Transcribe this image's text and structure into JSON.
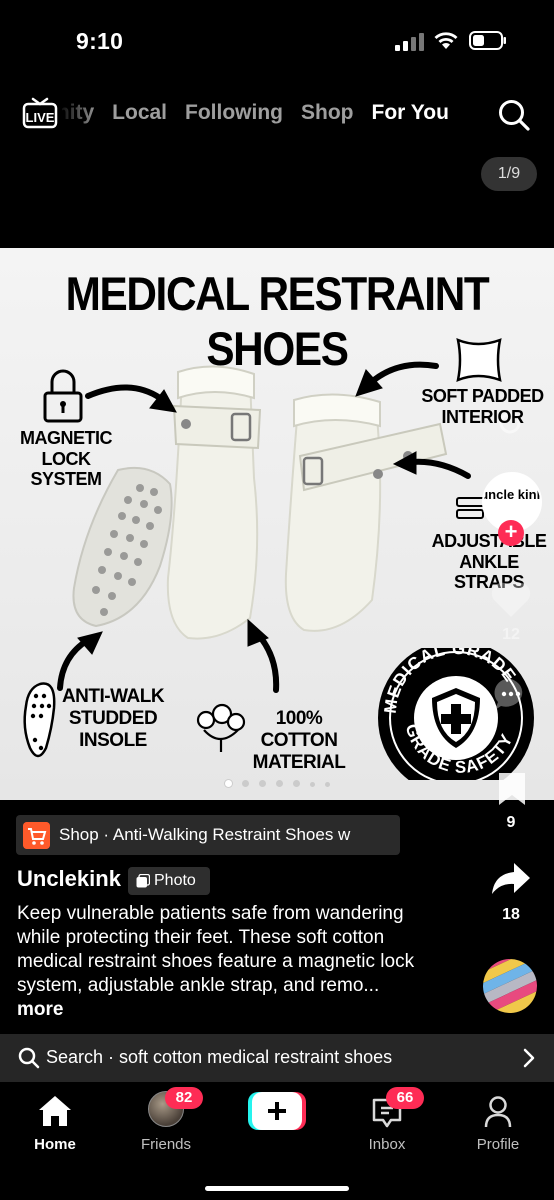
{
  "status_bar": {
    "time": "9:10"
  },
  "top_nav": {
    "live_label": "LIVE",
    "tabs": [
      "Community",
      "Local",
      "Following",
      "Shop",
      "For You"
    ],
    "visible_first_tab_fragment": "unity",
    "active_tab": "For You"
  },
  "page_counter": "1/9",
  "photo": {
    "title": "MEDICAL RESTRAINT SHOES",
    "labels": {
      "lock": "MAGNETIC LOCK SYSTEM",
      "padded": "SOFT PADDED INTERIOR",
      "straps": "ADJUSTABLE ANKLE STRAPS",
      "insole": "ANTI-WALK STUDDED INSOLE",
      "cotton": "100% COTTON MATERIAL"
    },
    "badge_text_top": "MEDICAL GRADE",
    "badge_text_bottom": "GRADE SAFETY",
    "carousel_total": 9,
    "carousel_active": 1
  },
  "rail": {
    "creator_logo_text": "uncle kink",
    "likes": "12",
    "saves": "9",
    "shares": "18"
  },
  "shop_chip": {
    "text": "Shop · Anti-Walking Restraint Shoes w"
  },
  "post": {
    "username": "Unclekink",
    "type_tag": "Photo",
    "caption": "Keep vulnerable patients safe from wandering while protecting their feet. These soft cotton medical restraint shoes feature a magnetic lock system, adjustable ankle strap, and remo...",
    "more_label": "more"
  },
  "search_bar": {
    "text": "Search · soft cotton medical restraint shoes"
  },
  "tabbar": {
    "home": "Home",
    "friends": "Friends",
    "friends_badge": "82",
    "inbox": "Inbox",
    "inbox_badge": "66",
    "profile": "Profile"
  },
  "colors": {
    "accent_red": "#fe2c55",
    "create_cyan": "#25f4ee",
    "shop_orange": "#ff5a2a"
  }
}
